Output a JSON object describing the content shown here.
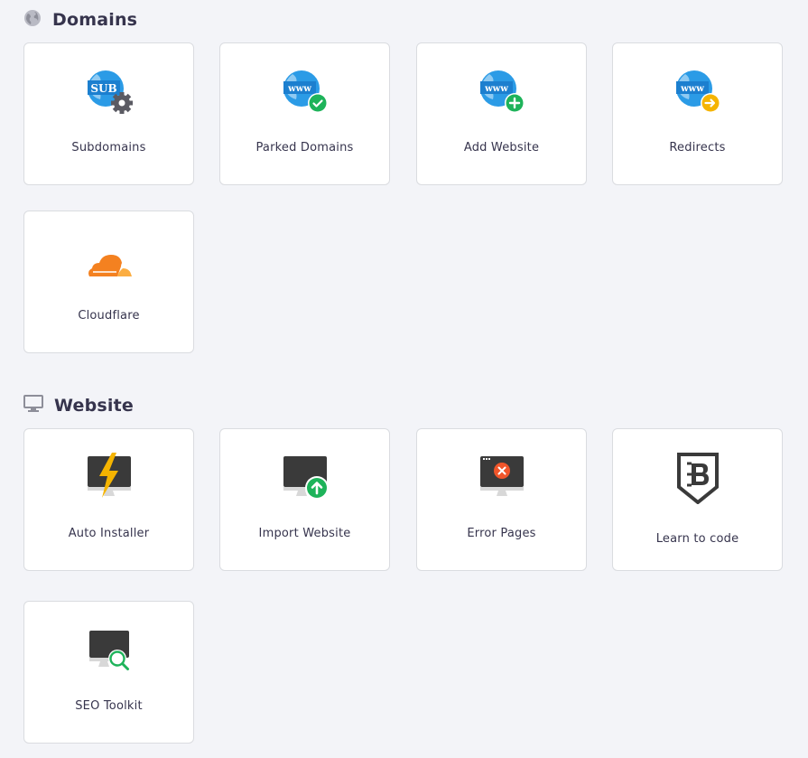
{
  "sections": {
    "domains": {
      "title": "Domains",
      "icon": "globe-icon",
      "items": [
        {
          "label": "Subdomains",
          "icon": "subdomain-globe-gear-icon"
        },
        {
          "label": "Parked Domains",
          "icon": "www-globe-check-icon"
        },
        {
          "label": "Add Website",
          "icon": "www-globe-plus-icon"
        },
        {
          "label": "Redirects",
          "icon": "www-globe-arrow-icon"
        },
        {
          "label": "Cloudflare",
          "icon": "cloudflare-cloud-icon"
        }
      ]
    },
    "website": {
      "title": "Website",
      "icon": "monitor-icon",
      "items": [
        {
          "label": "Auto Installer",
          "icon": "monitor-lightning-icon"
        },
        {
          "label": "Import Website",
          "icon": "monitor-upload-icon"
        },
        {
          "label": "Error Pages",
          "icon": "monitor-error-icon"
        },
        {
          "label": "Learn to code",
          "icon": "code-badge-b-icon"
        },
        {
          "label": "SEO Toolkit",
          "icon": "monitor-magnifier-icon"
        }
      ]
    }
  },
  "colors": {
    "background": "#f3f4f8",
    "card": "#ffffff",
    "globe_blue": "#2b9be6",
    "check_green": "#1eb35a",
    "arrow_yellow": "#f5b400",
    "cloudflare_orange": "#f48120",
    "monitor_dark": "#3a3a3a",
    "lightning_yellow": "#f5b400",
    "error_orange": "#f0552a"
  },
  "text": {
    "sub_badge": "SUB",
    "www_badge": "www"
  }
}
